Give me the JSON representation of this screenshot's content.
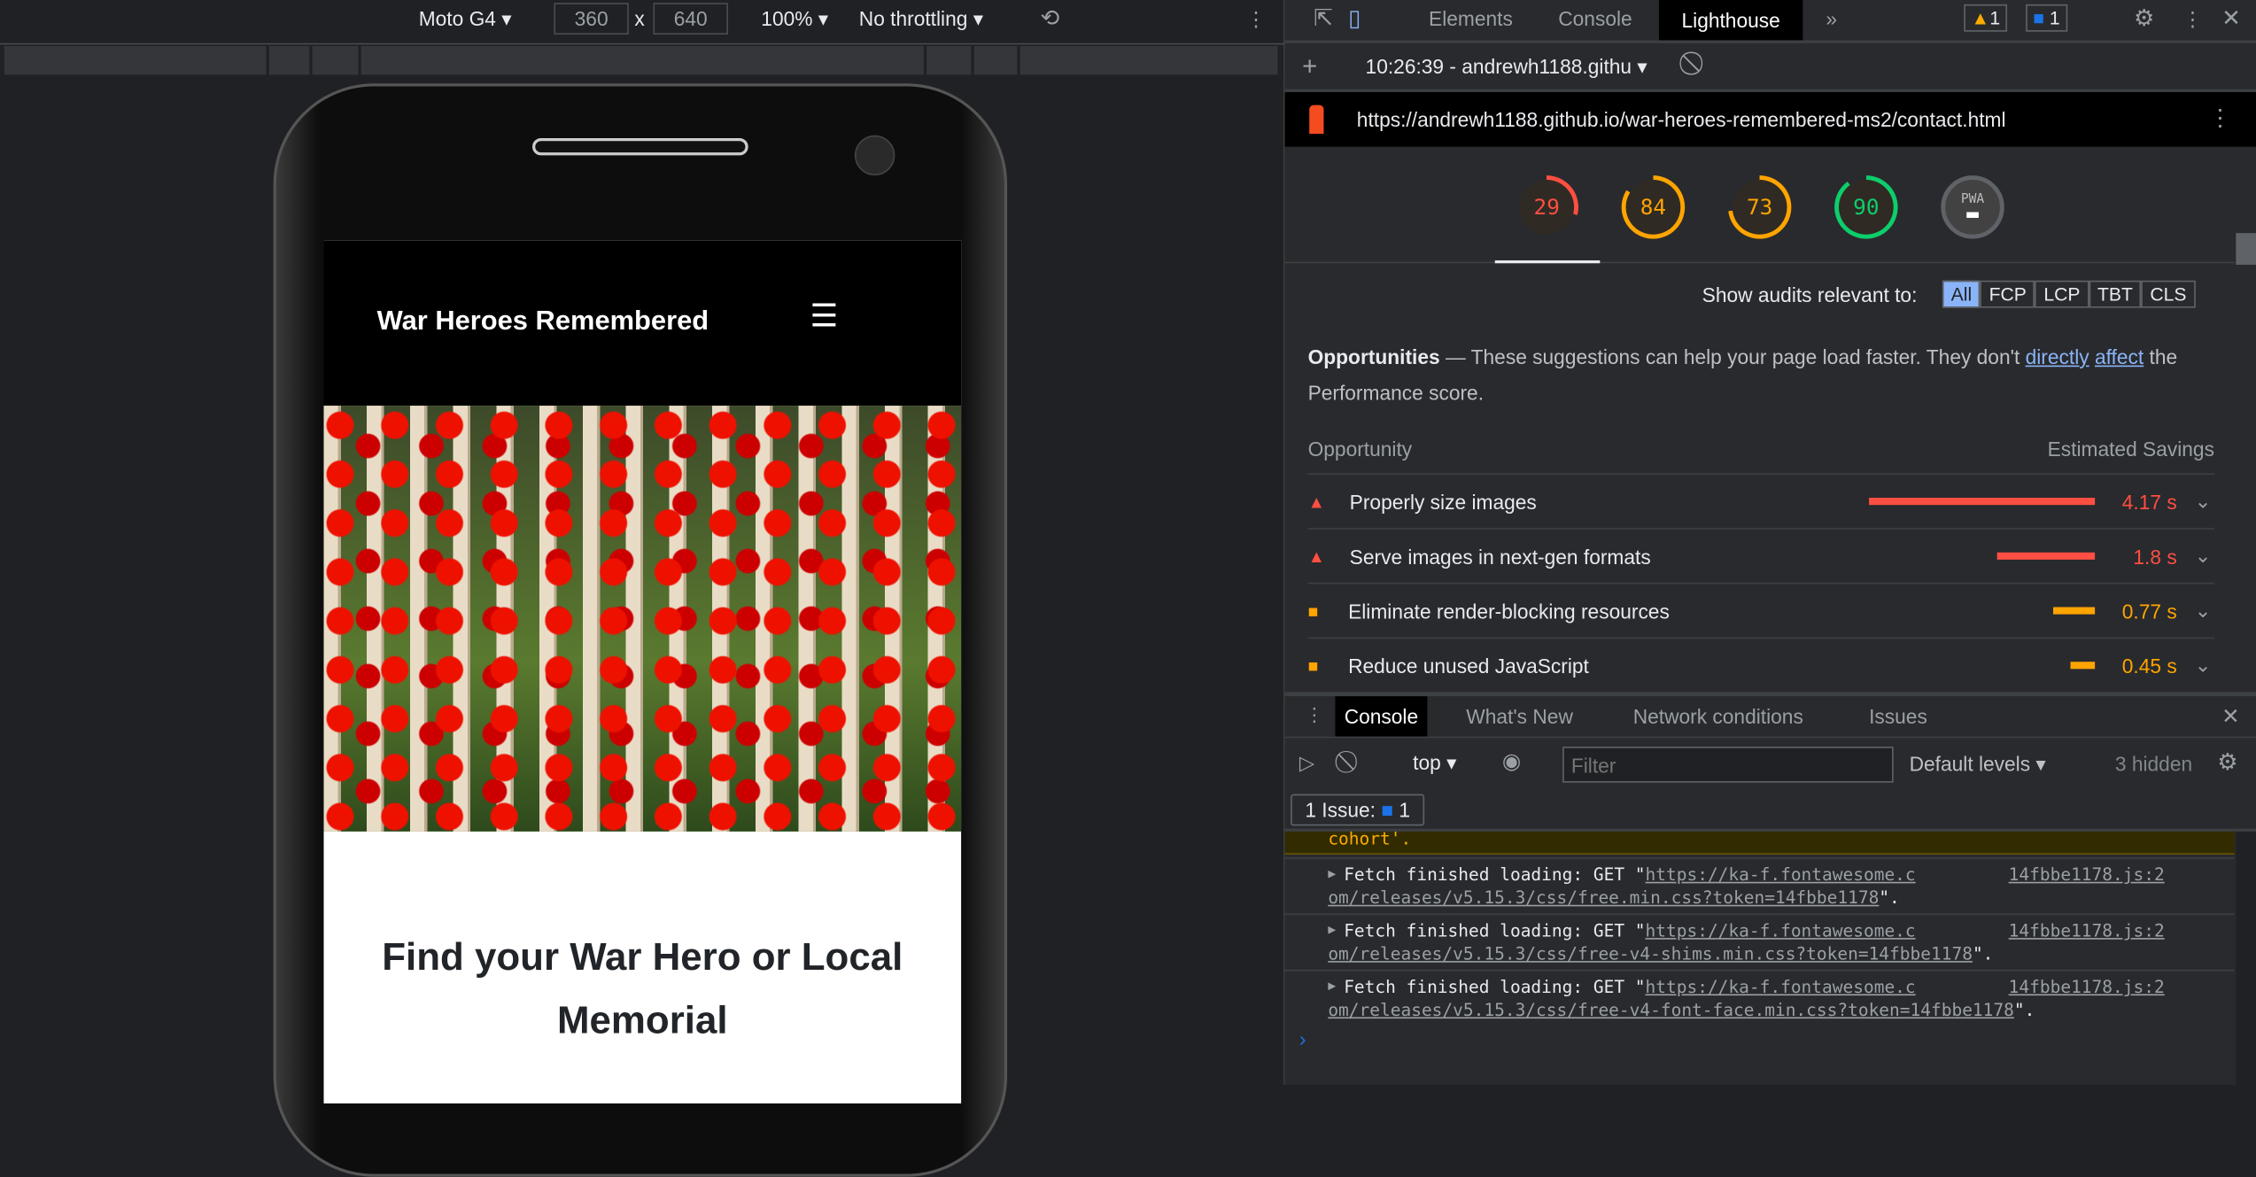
{
  "device_toolbar": {
    "device": "Moto G4",
    "width": "360",
    "height": "640",
    "times": "x",
    "zoom": "100%",
    "throttling": "No throttling"
  },
  "site": {
    "title": "War Heroes Remembered",
    "heading": "Find your War Hero or Local Memorial"
  },
  "devtools": {
    "tabs": [
      "Elements",
      "Console",
      "Lighthouse"
    ],
    "warnings": "1",
    "messages": "1",
    "report_label": "10:26:39 - andrewh1188.githu",
    "url": "https://andrewh1188.github.io/war-heroes-remembered-ms2/contact.html",
    "scores": [
      {
        "value": "29",
        "color": "#ff4e42",
        "fraction": 0.29
      },
      {
        "value": "84",
        "color": "#ffa400",
        "fraction": 0.84
      },
      {
        "value": "73",
        "color": "#ffa400",
        "fraction": 0.73
      },
      {
        "value": "90",
        "color": "#0cce6b",
        "fraction": 0.9
      }
    ],
    "pwa_label": "PWA",
    "audit_filter_label": "Show audits relevant to:",
    "audit_filters": [
      "All",
      "FCP",
      "LCP",
      "TBT",
      "CLS"
    ],
    "opp_title": "Opportunities",
    "opp_desc": "— These suggestions can help your page load faster. They don't",
    "opp_link1": "directly",
    "opp_link2": "affect",
    "opp_desc2": "the Performance score.",
    "col_opportunity": "Opportunity",
    "col_savings": "Estimated Savings",
    "opportunities": [
      {
        "label": "Properly size images",
        "savings": "4.17 s",
        "seconds": 4.17,
        "severity": "fail"
      },
      {
        "label": "Serve images in next-gen formats",
        "savings": "1.8 s",
        "seconds": 1.8,
        "severity": "fail"
      },
      {
        "label": "Eliminate render-blocking resources",
        "savings": "0.77 s",
        "seconds": 0.77,
        "severity": "average"
      },
      {
        "label": "Reduce unused JavaScript",
        "savings": "0.45 s",
        "seconds": 0.45,
        "severity": "average"
      }
    ]
  },
  "drawer": {
    "tabs": [
      "Console",
      "What's New",
      "Network conditions",
      "Issues"
    ],
    "context": "top",
    "filter_placeholder": "Filter",
    "levels": "Default levels",
    "hidden": "3 hidden",
    "issues_label": "1 Issue:",
    "issues_count": "1",
    "warning_tail": "cohort'.",
    "logs": [
      {
        "prefix": "Fetch finished loading: GET \"",
        "url1": "https://ka-f.fontawesome.c",
        "url2": "om/releases/v5.15.3/css/free.min.css?token=14fbbe1178",
        "suffix": "\".",
        "source": "14fbbe1178.js:2"
      },
      {
        "prefix": "Fetch finished loading: GET \"",
        "url1": "https://ka-f.fontawesome.c",
        "url2": "om/releases/v5.15.3/css/free-v4-shims.min.css?token=14fbbe1178",
        "suffix": "\".",
        "source": "14fbbe1178.js:2"
      },
      {
        "prefix": "Fetch finished loading: GET \"",
        "url1": "https://ka-f.fontawesome.c",
        "url2": "om/releases/v5.15.3/css/free-v4-font-face.min.css?token=14fbbe1178",
        "suffix": "\".",
        "source": "14fbbe1178.js:2"
      }
    ]
  }
}
